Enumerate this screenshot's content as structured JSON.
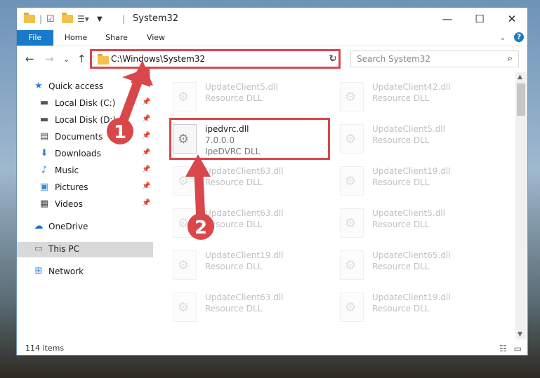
{
  "window": {
    "title": "System32",
    "minimize": "—",
    "maximize": "☐",
    "close": "✕"
  },
  "ribbon": {
    "tabs": [
      "File",
      "Home",
      "Share",
      "View"
    ],
    "help": "?",
    "expand": "⌄"
  },
  "navigation": {
    "back": "←",
    "forward": "→",
    "recent": "⌄",
    "up": "↑"
  },
  "address": {
    "path": "C:\\Windows\\System32",
    "dropdown": "⌄",
    "refresh": "↻"
  },
  "search": {
    "placeholder": "Search System32",
    "icon": "search-icon"
  },
  "sidebar": {
    "items": [
      {
        "label": "Quick access",
        "icon": "star-icon",
        "pinned": false
      },
      {
        "label": "Local Disk (C:)",
        "icon": "drive-icon",
        "pinned": true
      },
      {
        "label": "Local Disk (D:)",
        "icon": "drive-icon",
        "pinned": true
      },
      {
        "label": "Documents",
        "icon": "documents-icon",
        "pinned": true
      },
      {
        "label": "Downloads",
        "icon": "download-icon",
        "pinned": true
      },
      {
        "label": "Music",
        "icon": "music-icon",
        "pinned": true
      },
      {
        "label": "Pictures",
        "icon": "pictures-icon",
        "pinned": true
      },
      {
        "label": "Videos",
        "icon": "videos-icon",
        "pinned": true
      },
      {
        "label": "OneDrive",
        "icon": "cloud-icon",
        "pinned": false
      },
      {
        "label": "This PC",
        "icon": "computer-icon",
        "pinned": false,
        "selected": true
      },
      {
        "label": "Network",
        "icon": "network-icon",
        "pinned": false
      }
    ]
  },
  "files": {
    "highlighted": {
      "name": "ipedvrc.dll",
      "version": "7.0.0.0",
      "description": "IpeDVRC DLL"
    },
    "left_column": [
      {
        "name": "UpdateClient5.dll",
        "type": "Resource DLL"
      },
      {
        "name": "UpdateClient63.dll",
        "type": "Resource DLL"
      },
      {
        "name": "UpdateClient63.dll",
        "type": "Resource DLL"
      },
      {
        "name": "UpdateClient19.dll",
        "type": "Resource DLL"
      },
      {
        "name": "UpdateClient63.dll",
        "type": "Resource DLL"
      }
    ],
    "right_column": [
      {
        "name": "UpdateClient42.dll",
        "type": "Resource DLL"
      },
      {
        "name": "UpdateClient5.dll",
        "type": "Resource DLL"
      },
      {
        "name": "UpdateClient19.dll",
        "type": "Resource DLL"
      },
      {
        "name": "UpdateClient5.dll",
        "type": "Resource DLL"
      },
      {
        "name": "UpdateClient65.dll",
        "type": "Resource DLL"
      },
      {
        "name": "UpdateClient19.dll",
        "type": "Resource DLL"
      }
    ]
  },
  "status": {
    "item_count": "114 items"
  },
  "annotations": {
    "step1": "1",
    "step2": "2",
    "color": "#d9474b"
  }
}
